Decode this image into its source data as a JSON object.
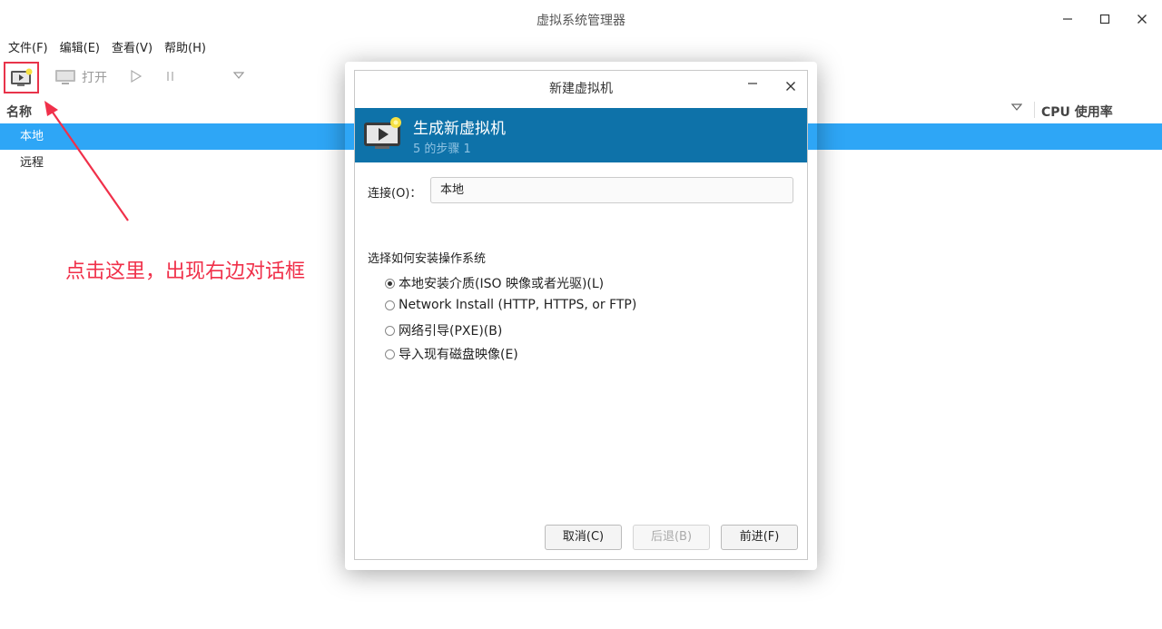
{
  "window": {
    "title": "虚拟系统管理器"
  },
  "menu": [
    "文件(F)",
    "编辑(E)",
    "查看(V)",
    "帮助(H)"
  ],
  "toolbar": {
    "open_label": "打开"
  },
  "list": {
    "col_name": "名称",
    "col_cpu": "CPU 使用率",
    "rows": [
      "本地",
      "远程"
    ]
  },
  "annotation": {
    "text": "点击这里，出现右边对话框",
    "color": "#f0304a"
  },
  "dialog": {
    "title": "新建虚拟机",
    "banner_title": "生成新虚拟机",
    "banner_subtitle": "5 的步骤 1",
    "connection_label": "连接(O)：",
    "connection_value": "本地",
    "section_label": "选择如何安装操作系统",
    "options": [
      "本地安装介质(ISO 映像或者光驱)(L)",
      "Network Install (HTTP, HTTPS, or FTP)",
      "网络引导(PXE)(B)",
      "导入现有磁盘映像(E)"
    ],
    "selected_option": 0,
    "buttons": {
      "cancel": "取消(C)",
      "back": "后退(B)",
      "forward": "前进(F)"
    }
  },
  "colors": {
    "selection": "#2ea6f6",
    "banner": "#0e72a9",
    "highlight_box": "#e8334a"
  }
}
